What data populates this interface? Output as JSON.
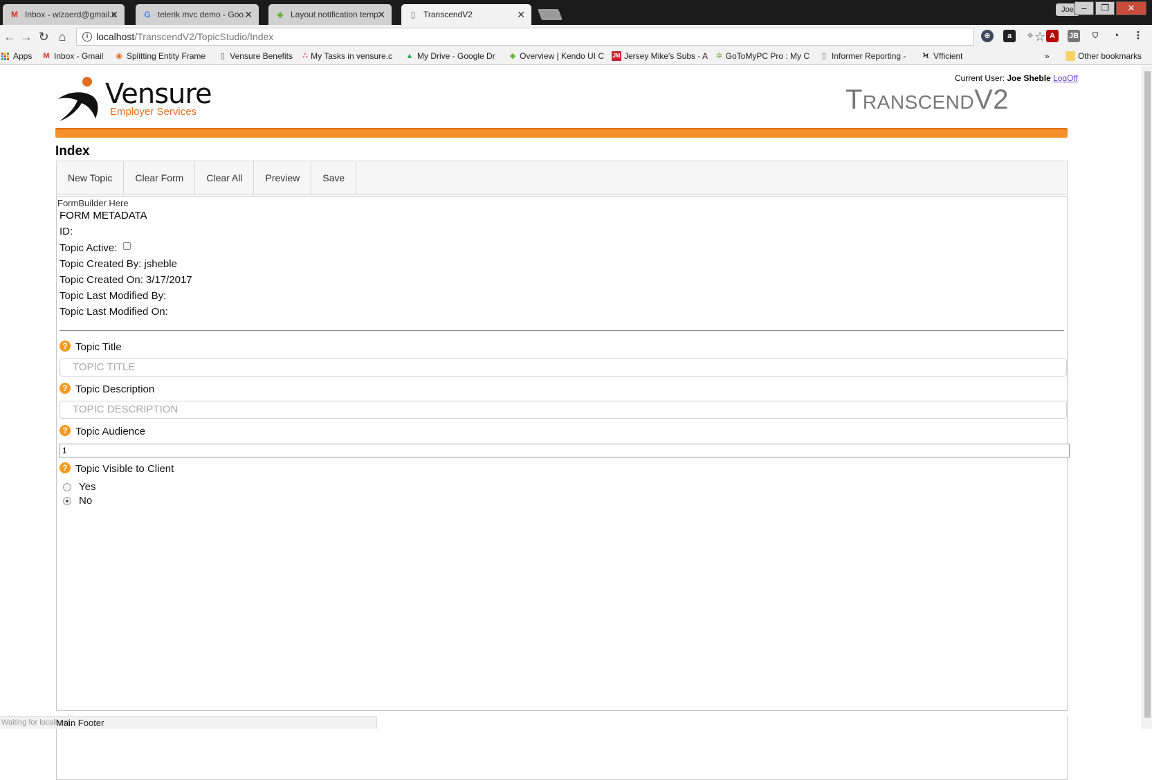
{
  "browser": {
    "tabs": [
      {
        "title": "Inbox - wizaerd@gmail.c",
        "icon": "gmail-icon",
        "active": false
      },
      {
        "title": "telerik mvc demo - Goo",
        "icon": "google-icon",
        "active": false
      },
      {
        "title": "Layout notification temp",
        "icon": "kendo-icon",
        "active": false
      },
      {
        "title": "TranscendV2",
        "icon": "page-icon",
        "active": true
      }
    ],
    "profile_label": "Joe",
    "url_host": "localhost",
    "url_path": "/TranscendV2/TopicStudio/Index",
    "bookmarks": [
      {
        "label": "Apps",
        "icon": "apps-icon"
      },
      {
        "label": "Inbox - Gmail",
        "icon": "gmail-icon"
      },
      {
        "label": "Splitting Entity Frame",
        "icon": "generic-favicon"
      },
      {
        "label": "Vensure Benefits",
        "icon": "page-icon"
      },
      {
        "label": "My Tasks in vensure.c",
        "icon": "asana-icon"
      },
      {
        "label": "My Drive - Google Dr",
        "icon": "drive-icon"
      },
      {
        "label": "Overview | Kendo UI C",
        "icon": "kendo-icon"
      },
      {
        "label": "Jersey Mike's Subs - A",
        "icon": "jerseymikes-icon"
      },
      {
        "label": "GoToMyPC Pro : My C",
        "icon": "gotomypc-icon"
      },
      {
        "label": "Informer Reporting -",
        "icon": "page-icon"
      },
      {
        "label": "Vfficient",
        "icon": "vfficient-icon"
      }
    ],
    "overflow_label": "»",
    "other_bookmarks_label": "Other bookmarks",
    "status_text": "Waiting for localhost..."
  },
  "header": {
    "current_user_label": "Current User:",
    "current_user_name": "Joe Sheble",
    "logoff_label": "LogOff",
    "logo_name": "Vensure",
    "logo_subtitle": "Employer Services",
    "site_title": "TranscendV2",
    "accent_color": "#f5922a"
  },
  "page": {
    "heading": "Index",
    "toolbar_buttons": [
      "New Topic",
      "Clear Form",
      "Clear All",
      "Preview",
      "Save"
    ],
    "formbuilder_label": "FormBuilder Here",
    "metadata": {
      "title": "FORM METADATA",
      "id_label": "ID:",
      "id_value": "",
      "active_label": "Topic Active:",
      "active_checked": false,
      "created_by_label": "Topic Created By:",
      "created_by_value": "jsheble",
      "created_on_label": "Topic Created On:",
      "created_on_value": "3/17/2017",
      "modified_by_label": "Topic Last Modified By:",
      "modified_by_value": "",
      "modified_on_label": "Topic Last Modified On:",
      "modified_on_value": ""
    },
    "fields": {
      "title_label": "Topic Title",
      "title_placeholder": "TOPIC TITLE",
      "description_label": "Topic Description",
      "description_placeholder": "TOPIC DESCRIPTION",
      "audience_label": "Topic Audience",
      "audience_value": "1",
      "visible_label": "Topic Visible to Client",
      "visible_options": [
        "Yes",
        "No"
      ],
      "visible_selected": "No"
    },
    "footer_text": "Main Footer"
  }
}
